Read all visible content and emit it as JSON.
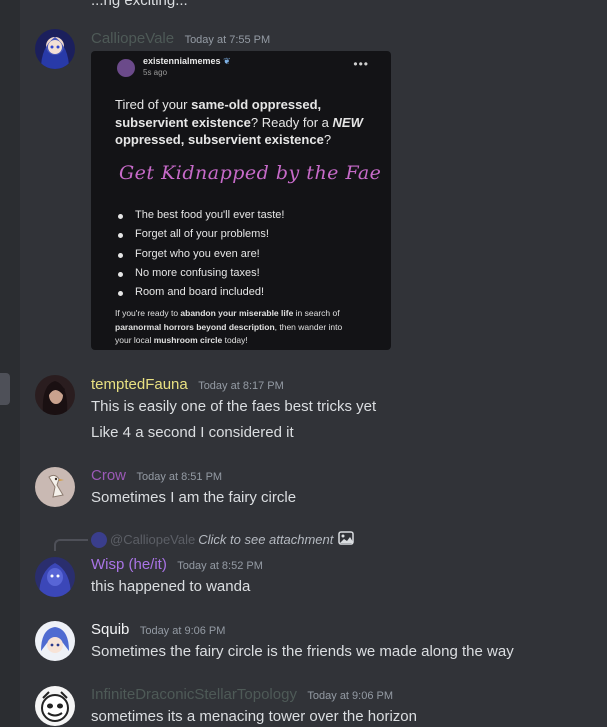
{
  "top_fragment": "...ng exciting...",
  "messages": [
    {
      "author": "CalliopeVale",
      "name_color": "#4e5a57",
      "timestamp": "Today at 7:55 PM",
      "attachment": {
        "username": "existennialmemes",
        "time": "5s ago",
        "intro_1": "Tired of your ",
        "intro_1b": "same-old oppressed,",
        "intro_2": "subservient existence",
        "intro_3": "? Ready for a ",
        "intro_new": "NEW",
        "intro_4": "oppressed, subservient existence",
        "intro_5": "?",
        "headline": "Get Kidnapped by the Fae",
        "bullets": [
          "The best food you'll ever taste!",
          "Forget all of your problems!",
          "Forget who you even are!",
          "No more confusing taxes!",
          "Room and board included!"
        ],
        "footer_1": "If you're ready to ",
        "footer_1b": "abandon your miserable life",
        "footer_1c": " in search of",
        "footer_2": "paranormal horrors beyond description",
        "footer_2b": ", then wander into",
        "footer_3": "your local ",
        "footer_3b": "mushroom circle",
        "footer_3c": " today!"
      }
    },
    {
      "author": "temptedFauna",
      "name_color": "#e8e081",
      "timestamp": "Today at 8:17 PM",
      "lines": [
        "This is easily one of the faes best tricks yet",
        "Like 4 a second I considered it"
      ]
    },
    {
      "author": "Crow",
      "name_color": "#9b59b6",
      "timestamp": "Today at 8:51 PM",
      "lines": [
        "Sometimes I am the fairy circle"
      ]
    },
    {
      "reply": {
        "name": "@CalliopeVale",
        "text": "Click to see attachment",
        "icon": "image-icon"
      },
      "author": "Wisp (he/it)",
      "name_color": "#a974e6",
      "timestamp": "Today at 8:52 PM",
      "lines": [
        "this happened to wanda"
      ]
    },
    {
      "author": "Squib",
      "name_color": "#f2f3f5",
      "timestamp": "Today at 9:06 PM",
      "lines": [
        "Sometimes the fairy circle is the friends we made along the way"
      ]
    },
    {
      "author": "InfiniteDraconicStellarTopology",
      "name_color": "#4e5a57",
      "timestamp": "Today at 9:06 PM",
      "lines": [
        "sometimes its a menacing tower over the horizon"
      ]
    }
  ]
}
